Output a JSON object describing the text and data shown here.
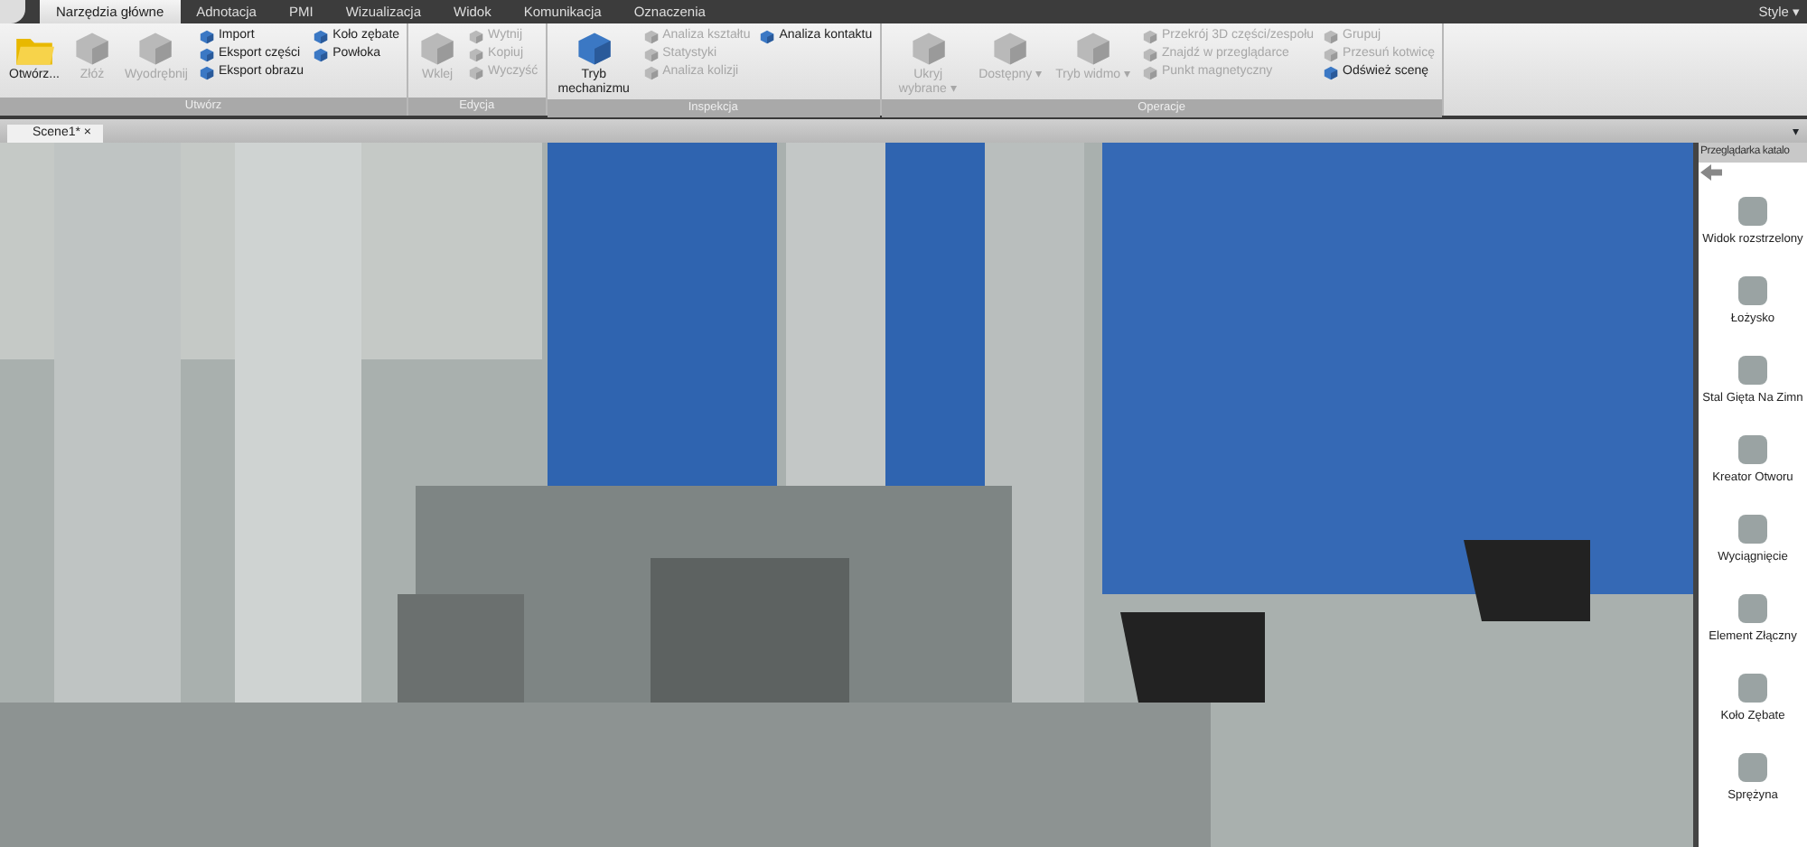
{
  "menu_tabs": [
    {
      "label": "Narzędzia główne",
      "selected": true
    },
    {
      "label": "Adnotacja",
      "selected": false
    },
    {
      "label": "PMI",
      "selected": false
    },
    {
      "label": "Wizualizacja",
      "selected": false
    },
    {
      "label": "Widok",
      "selected": false
    },
    {
      "label": "Komunikacja",
      "selected": false
    },
    {
      "label": "Oznaczenia",
      "selected": false
    }
  ],
  "style_menu": {
    "label": "Style",
    "caret": "▾"
  },
  "ribbon_groups": [
    {
      "title": "Utwórz",
      "columns": [
        [
          {
            "kind": "large",
            "label": "Otwórz...",
            "disabled": false
          }
        ],
        [
          {
            "kind": "large",
            "label": "Złóż",
            "disabled": true
          }
        ],
        [
          {
            "kind": "large",
            "label": "Wyodrębnij",
            "disabled": true
          }
        ],
        [
          {
            "kind": "small",
            "label": "Import",
            "disabled": false
          },
          {
            "kind": "small",
            "label": "Eksport części",
            "disabled": false
          },
          {
            "kind": "small",
            "label": "Eksport obrazu",
            "disabled": false
          }
        ],
        [
          {
            "kind": "small",
            "label": "Koło zębate",
            "disabled": false
          },
          {
            "kind": "small",
            "label": "Powłoka",
            "disabled": false
          }
        ]
      ]
    },
    {
      "title": "Edycja",
      "columns": [
        [
          {
            "kind": "large",
            "label": "Wklej",
            "disabled": true
          }
        ],
        [
          {
            "kind": "small",
            "label": "Wytnij",
            "disabled": true
          },
          {
            "kind": "small",
            "label": "Kopiuj",
            "disabled": true
          },
          {
            "kind": "small",
            "label": "Wyczyść",
            "disabled": true
          }
        ]
      ]
    },
    {
      "title": "Inspekcja",
      "columns": [
        [
          {
            "kind": "large",
            "label": "Tryb mechanizmu",
            "disabled": false
          }
        ],
        [
          {
            "kind": "small",
            "label": "Analiza kształtu",
            "disabled": true
          },
          {
            "kind": "small",
            "label": "Statystyki",
            "disabled": true
          },
          {
            "kind": "small",
            "label": "Analiza kolizji",
            "disabled": true
          }
        ],
        [
          {
            "kind": "small",
            "label": "Analiza kontaktu",
            "disabled": false
          }
        ]
      ]
    },
    {
      "title": "Operacje",
      "columns": [
        [
          {
            "kind": "large",
            "label": "Ukryj wybrane",
            "caret": "▾",
            "disabled": true
          }
        ],
        [
          {
            "kind": "large",
            "label": "Dostępny",
            "caret": "▾",
            "disabled": true
          }
        ],
        [
          {
            "kind": "large",
            "label": "Tryb widmo",
            "caret": "▾",
            "disabled": true
          }
        ],
        [
          {
            "kind": "small",
            "label": "Przekrój 3D części/zespołu",
            "disabled": true
          },
          {
            "kind": "small",
            "label": "Znajdź w przeglądarce",
            "disabled": true
          },
          {
            "kind": "small",
            "label": "Punkt magnetyczny",
            "disabled": true
          }
        ],
        [
          {
            "kind": "small",
            "label": "Grupuj",
            "disabled": true
          },
          {
            "kind": "small",
            "label": "Przesuń kotwicę",
            "disabled": true
          },
          {
            "kind": "small",
            "label": "Odśwież scenę",
            "disabled": false
          }
        ]
      ]
    }
  ],
  "document_tabs": [
    {
      "label": "Scene1*",
      "close": "×"
    }
  ],
  "document_menu_caret": "▾",
  "catalog": {
    "title": "Przeglądarka katalo",
    "items": [
      {
        "label": "Widok rozstrzelony"
      },
      {
        "label": "Łożysko"
      },
      {
        "label": "Stal Gięta Na Zimn"
      },
      {
        "label": "Kreator Otworu"
      },
      {
        "label": "Wyciągnięcie"
      },
      {
        "label": "Element Złączny"
      },
      {
        "label": "Koło Zębate"
      },
      {
        "label": "Sprężyna"
      }
    ]
  }
}
